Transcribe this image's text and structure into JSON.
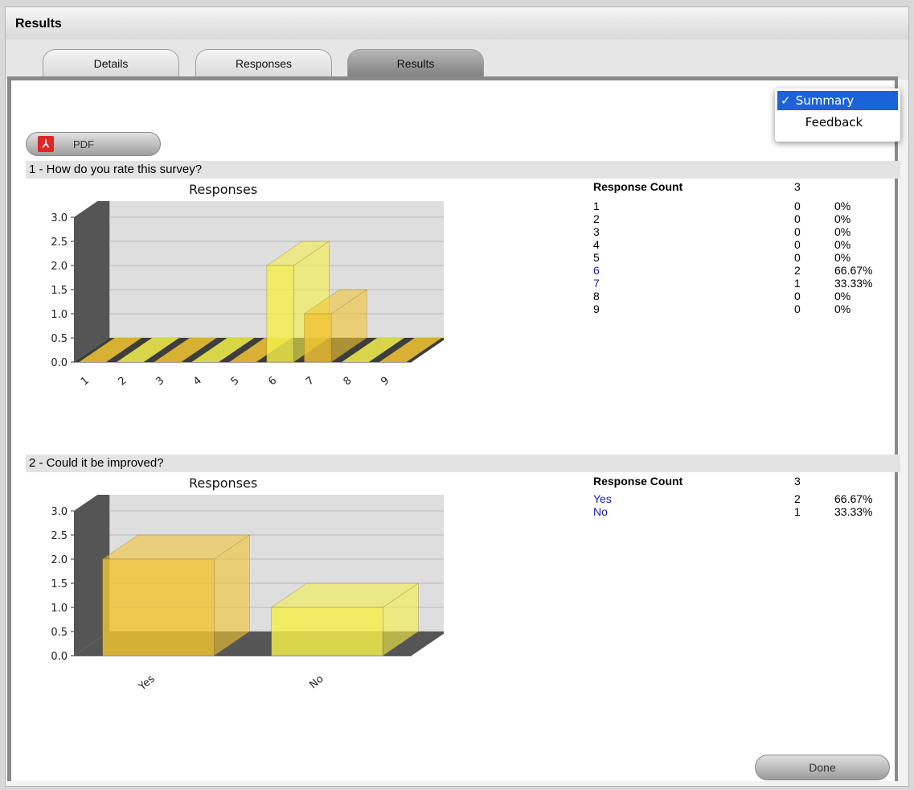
{
  "window": {
    "title": "Results"
  },
  "tabs": [
    {
      "label": "Details",
      "active": false
    },
    {
      "label": "Responses",
      "active": false
    },
    {
      "label": "Results",
      "active": true
    }
  ],
  "view_menu": {
    "items": [
      {
        "label": "Summary",
        "selected": true,
        "check": "✓"
      },
      {
        "label": "Feedback",
        "selected": false
      }
    ]
  },
  "pdf_button": {
    "label": "PDF",
    "icon": "pdf-icon"
  },
  "questions": [
    {
      "title": "1 - How do you rate this survey?",
      "chart_title": "Responses",
      "response_count_label": "Response Count",
      "response_count": "3",
      "rows": [
        {
          "label": "1",
          "count": "0",
          "pct": "0%",
          "link": false
        },
        {
          "label": "2",
          "count": "0",
          "pct": "0%",
          "link": false
        },
        {
          "label": "3",
          "count": "0",
          "pct": "0%",
          "link": false
        },
        {
          "label": "4",
          "count": "0",
          "pct": "0%",
          "link": false
        },
        {
          "label": "5",
          "count": "0",
          "pct": "0%",
          "link": false
        },
        {
          "label": "6",
          "count": "2",
          "pct": "66.67%",
          "link": true
        },
        {
          "label": "7",
          "count": "1",
          "pct": "33.33%",
          "link": true
        },
        {
          "label": "8",
          "count": "0",
          "pct": "0%",
          "link": false
        },
        {
          "label": "9",
          "count": "0",
          "pct": "0%",
          "link": false
        }
      ]
    },
    {
      "title": "2 - Could it be improved?",
      "chart_title": "Responses",
      "response_count_label": "Response Count",
      "response_count": "3",
      "rows": [
        {
          "label": "Yes",
          "count": "2",
          "pct": "66.67%",
          "link": true
        },
        {
          "label": "No",
          "count": "1",
          "pct": "33.33%",
          "link": true
        }
      ]
    }
  ],
  "done_button": {
    "label": "Done"
  },
  "colors": {
    "bar_yellow": "#f5f04a",
    "bar_gold": "#f2c433",
    "plot_bg": "#dedede",
    "wall_dark": "#555555"
  },
  "chart_data": [
    {
      "type": "bar",
      "title": "Responses",
      "categories": [
        "1",
        "2",
        "3",
        "4",
        "5",
        "6",
        "7",
        "8",
        "9"
      ],
      "values": [
        0,
        0,
        0,
        0,
        0,
        2,
        1,
        0,
        0
      ],
      "xlabel": "",
      "ylabel": "",
      "ylim": [
        0,
        3
      ],
      "yticks": [
        "0.0",
        "0.5",
        "1.0",
        "1.5",
        "2.0",
        "2.5",
        "3.0"
      ],
      "grid": true
    },
    {
      "type": "bar",
      "title": "Responses",
      "categories": [
        "Yes",
        "No"
      ],
      "values": [
        2,
        1
      ],
      "xlabel": "",
      "ylabel": "",
      "ylim": [
        0,
        3
      ],
      "yticks": [
        "0.0",
        "0.5",
        "1.0",
        "1.5",
        "2.0",
        "2.5",
        "3.0"
      ],
      "grid": true
    }
  ]
}
